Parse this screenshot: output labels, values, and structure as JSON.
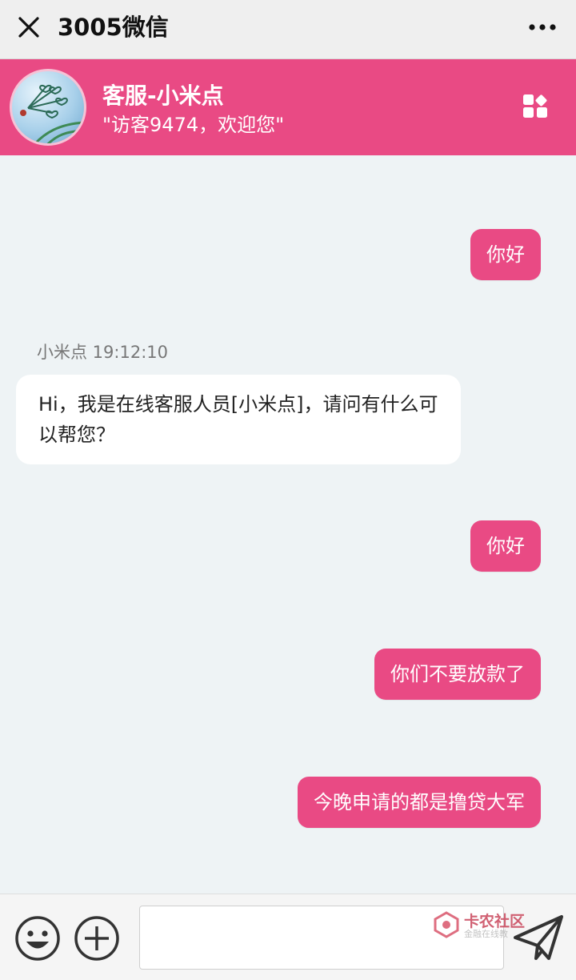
{
  "topbar": {
    "title": "3005微信",
    "close_icon": "close-icon",
    "more_icon": "more-icon"
  },
  "header": {
    "agent_name": "客服-小米点",
    "greeting": "\"访客9474，欢迎您\"",
    "background": "#e94a84",
    "avatar_icon": "avatar-dandelion-image",
    "menu_icon": "app-grid-icon"
  },
  "chat": {
    "outgoing_color": "#e94a84",
    "messages": [
      {
        "from": "visitor",
        "text": "你好"
      },
      {
        "from": "agent",
        "meta": "小米点 19:12:10",
        "text": "Hi，我是在线客服人员[小米点]，请问有什么可以帮您？"
      },
      {
        "from": "visitor",
        "text": "你好"
      },
      {
        "from": "visitor",
        "text": "你们不要放款了"
      },
      {
        "from": "visitor",
        "text": "今晚申请的都是撸贷大军"
      }
    ]
  },
  "inputbar": {
    "emoji_icon": "emoji-icon",
    "plus_icon": "plus-icon",
    "input_value": "",
    "send_icon": "send-icon"
  },
  "watermark": {
    "text": "卡农社区",
    "sub": "金融在线教"
  }
}
